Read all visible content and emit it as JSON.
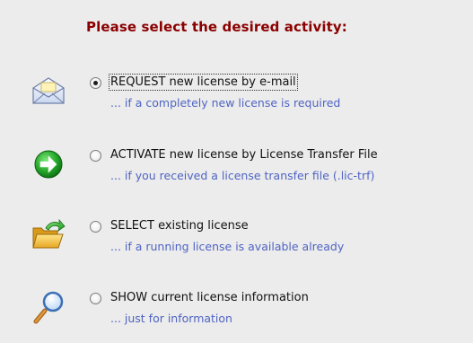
{
  "heading": "Please select the desired activity:",
  "options": [
    {
      "label": "REQUEST new license by e-mail",
      "hint": "... if a completely new license is required",
      "icon": "envelope-icon",
      "selected": true
    },
    {
      "label": "ACTIVATE new license by License Transfer File",
      "hint": "... if you received a license transfer file (.lic-trf)",
      "icon": "arrow-right-circle-icon",
      "selected": false
    },
    {
      "label": "SELECT existing license",
      "hint": "... if a running license is available already",
      "icon": "folder-arrow-icon",
      "selected": false
    },
    {
      "label": "SHOW current license information",
      "hint": "... just for information",
      "icon": "magnifier-icon",
      "selected": false
    }
  ],
  "colors": {
    "heading": "#8b0000",
    "hint": "#4f64c3",
    "background": "#ececec"
  }
}
